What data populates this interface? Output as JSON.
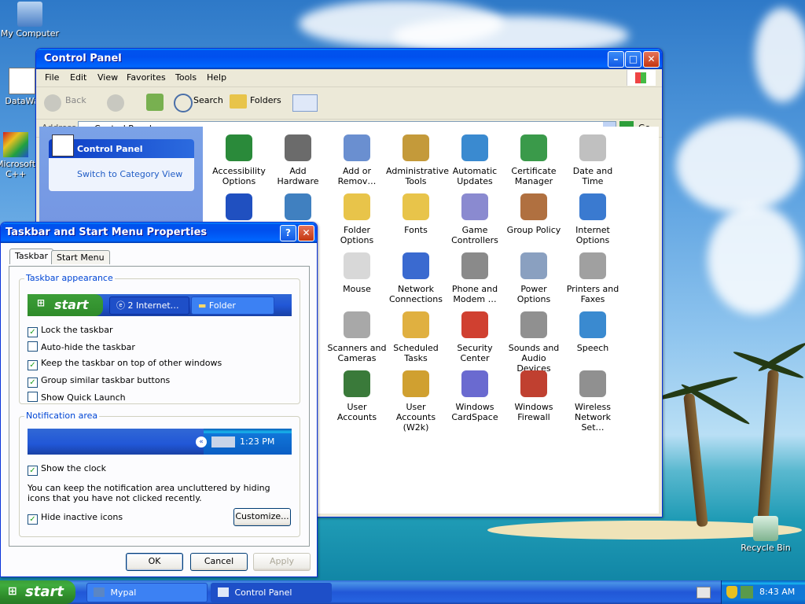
{
  "desktop": {
    "icons": [
      {
        "label": "My Computer"
      },
      {
        "label": "DataWa"
      },
      {
        "label": "Microsoft C++"
      },
      {
        "label": "Recycle Bin"
      }
    ]
  },
  "control_panel": {
    "title": "Control Panel",
    "menu": [
      "File",
      "Edit",
      "View",
      "Favorites",
      "Tools",
      "Help"
    ],
    "toolbar": {
      "back": "Back",
      "search": "Search",
      "folders": "Folders"
    },
    "address": {
      "label": "Address",
      "value": "Control Panel",
      "go": "Go"
    },
    "sidepane": {
      "title": "Control Panel",
      "switch_link": "Switch to Category View"
    },
    "items": [
      {
        "label": "Accessibility Options",
        "color": "#2a8a3a"
      },
      {
        "label": "Add Hardware",
        "color": "#6b6b6b"
      },
      {
        "label": "Add or Remov…",
        "color": "#6a8fd0"
      },
      {
        "label": "Administrative Tools",
        "color": "#c49a3a"
      },
      {
        "label": "Automatic Updates",
        "color": "#3a8ad0"
      },
      {
        "label": "Certificate Manager",
        "color": "#3a9a4a"
      },
      {
        "label": "Date and Time",
        "color": "#c0c0c0"
      },
      {
        "label": "Folder Options",
        "color": "#e8c44a"
      },
      {
        "label": "Fonts",
        "color": "#e8c44a"
      },
      {
        "label": "Game Controllers",
        "color": "#8a8ad0"
      },
      {
        "label": "Group Policy",
        "color": "#b07040"
      },
      {
        "label": "Internet Options",
        "color": "#3a7ad0"
      },
      {
        "label": "Mouse",
        "color": "#d8d8d8"
      },
      {
        "label": "Network Connections",
        "color": "#3a6ad0"
      },
      {
        "label": "Phone and Modem …",
        "color": "#8a8a8a"
      },
      {
        "label": "Power Options",
        "color": "#8aa0c0"
      },
      {
        "label": "Printers and Faxes",
        "color": "#a0a0a0"
      },
      {
        "label": "Scanners and Cameras",
        "color": "#a8a8a8"
      },
      {
        "label": "Scheduled Tasks",
        "color": "#e0b040"
      },
      {
        "label": "Security Center",
        "color": "#d04030"
      },
      {
        "label": "Sounds and Audio Devices",
        "color": "#909090"
      },
      {
        "label": "Speech",
        "color": "#3a8ad0"
      },
      {
        "label": "User Accounts",
        "color": "#3a7a3a"
      },
      {
        "label": "User Accounts (W2k)",
        "color": "#d0a030"
      },
      {
        "label": "Windows CardSpace",
        "color": "#6a6ad0"
      },
      {
        "label": "Windows Firewall",
        "color": "#c04030"
      },
      {
        "label": "Wireless Network Set…",
        "color": "#909090"
      }
    ]
  },
  "dialog": {
    "title": "Taskbar and Start Menu Properties",
    "tabs": [
      "Taskbar",
      "Start Menu"
    ],
    "appearance_legend": "Taskbar appearance",
    "preview": {
      "start": "start",
      "ie_button": "2 Internet…",
      "folder_button": "Folder"
    },
    "checkboxes": [
      {
        "label": "Lock the taskbar",
        "checked": true
      },
      {
        "label": "Auto-hide the taskbar",
        "checked": false
      },
      {
        "label": "Keep the taskbar on top of other windows",
        "checked": true
      },
      {
        "label": "Group similar taskbar buttons",
        "checked": true
      },
      {
        "label": "Show Quick Launch",
        "checked": false
      }
    ],
    "notification_legend": "Notification area",
    "notification_time": "1:23 PM",
    "show_clock": {
      "label": "Show the clock",
      "checked": true
    },
    "description": "You can keep the notification area uncluttered by hiding icons that you have not clicked recently.",
    "hide_inactive": {
      "label": "Hide inactive icons",
      "checked": true
    },
    "customize": "Customize...",
    "ok": "OK",
    "cancel": "Cancel",
    "apply": "Apply"
  },
  "taskbar": {
    "start": "start",
    "items": [
      {
        "label": "Mypal"
      },
      {
        "label": "Control Panel"
      }
    ],
    "clock": "8:43 AM"
  }
}
